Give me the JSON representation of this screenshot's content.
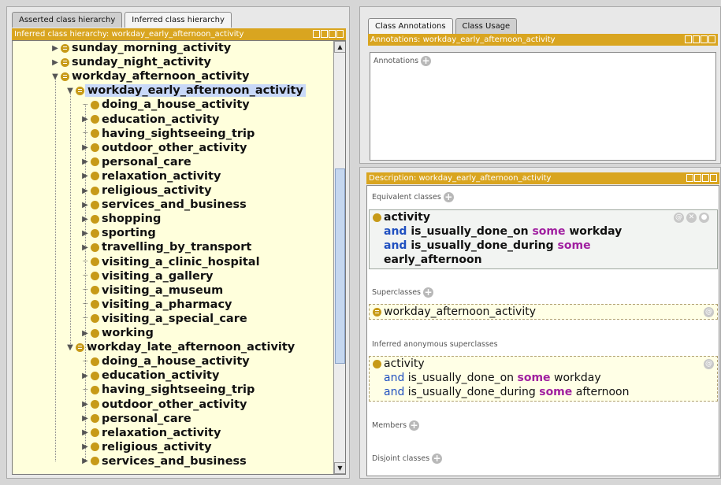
{
  "left_tabs": [
    "Asserted class hierarchy",
    "Inferred class hierarchy"
  ],
  "left_title": "Inferred class hierarchy: workday_early_afternoon_activity",
  "right_tabs": [
    "Class Annotations",
    "Class Usage"
  ],
  "annotations_title": "Annotations: workday_early_afternoon_activity",
  "annotations_label": "Annotations",
  "description_title": "Description: workday_early_afternoon_activity",
  "tree": [
    {
      "label": "sunday_morning_activity",
      "level": 0,
      "arrow": "right",
      "icon": "equivalent"
    },
    {
      "label": "sunday_night_activity",
      "level": 0,
      "arrow": "right",
      "icon": "equivalent"
    },
    {
      "label": "workday_afternoon_activity",
      "level": 0,
      "arrow": "down",
      "icon": "equivalent"
    },
    {
      "label": "workday_early_afternoon_activity",
      "level": 1,
      "arrow": "down",
      "icon": "equivalent",
      "selected": true
    },
    {
      "label": "doing_a_house_activity",
      "level": 2,
      "arrow": "none",
      "icon": "class"
    },
    {
      "label": "education_activity",
      "level": 2,
      "arrow": "right",
      "icon": "class"
    },
    {
      "label": "having_sightseeing_trip",
      "level": 2,
      "arrow": "none",
      "icon": "class"
    },
    {
      "label": "outdoor_other_activity",
      "level": 2,
      "arrow": "right",
      "icon": "class"
    },
    {
      "label": "personal_care",
      "level": 2,
      "arrow": "right",
      "icon": "class"
    },
    {
      "label": "relaxation_activity",
      "level": 2,
      "arrow": "right",
      "icon": "class"
    },
    {
      "label": "religious_activity",
      "level": 2,
      "arrow": "right",
      "icon": "class"
    },
    {
      "label": "services_and_business",
      "level": 2,
      "arrow": "right",
      "icon": "class"
    },
    {
      "label": "shopping",
      "level": 2,
      "arrow": "right",
      "icon": "class"
    },
    {
      "label": "sporting",
      "level": 2,
      "arrow": "right",
      "icon": "class"
    },
    {
      "label": "travelling_by_transport",
      "level": 2,
      "arrow": "right",
      "icon": "class"
    },
    {
      "label": "visiting_a_clinic_hospital",
      "level": 2,
      "arrow": "none",
      "icon": "class"
    },
    {
      "label": "visiting_a_gallery",
      "level": 2,
      "arrow": "none",
      "icon": "class"
    },
    {
      "label": "visiting_a_museum",
      "level": 2,
      "arrow": "none",
      "icon": "class"
    },
    {
      "label": "visiting_a_pharmacy",
      "level": 2,
      "arrow": "none",
      "icon": "class"
    },
    {
      "label": "visiting_a_special_care",
      "level": 2,
      "arrow": "none",
      "icon": "class"
    },
    {
      "label": "working",
      "level": 2,
      "arrow": "right",
      "icon": "class"
    },
    {
      "label": "workday_late_afternoon_activity",
      "level": 1,
      "arrow": "down",
      "icon": "equivalent"
    },
    {
      "label": "doing_a_house_activity",
      "level": 2,
      "arrow": "none",
      "icon": "class"
    },
    {
      "label": "education_activity",
      "level": 2,
      "arrow": "right",
      "icon": "class"
    },
    {
      "label": "having_sightseeing_trip",
      "level": 2,
      "arrow": "none",
      "icon": "class"
    },
    {
      "label": "outdoor_other_activity",
      "level": 2,
      "arrow": "right",
      "icon": "class"
    },
    {
      "label": "personal_care",
      "level": 2,
      "arrow": "right",
      "icon": "class"
    },
    {
      "label": "relaxation_activity",
      "level": 2,
      "arrow": "right",
      "icon": "class"
    },
    {
      "label": "religious_activity",
      "level": 2,
      "arrow": "right",
      "icon": "class"
    },
    {
      "label": "services_and_business",
      "level": 2,
      "arrow": "right",
      "icon": "class"
    }
  ],
  "equivalent": {
    "label": "Equivalent classes",
    "lines": [
      "activity",
      "is_usually_done_on",
      "workday",
      "is_usually_done_during",
      "early_afternoon"
    ],
    "and": "and",
    "some": "some"
  },
  "superclasses": {
    "label": "Superclasses",
    "value": "workday_afternoon_activity"
  },
  "inferred": {
    "label": "Inferred anonymous superclasses",
    "base": "activity",
    "prop1": "is_usually_done_on",
    "val1": "workday",
    "prop2": "is_usually_done_during",
    "val2": "afternoon"
  },
  "members_label": "Members",
  "disjoint_label": "Disjoint classes",
  "colors": {
    "title_bar": "#d9a520",
    "tree_bg": "#ffffdc",
    "class_icon": "#c79a18",
    "keyword": "#a020a0",
    "and_keyword": "#2050c0"
  }
}
